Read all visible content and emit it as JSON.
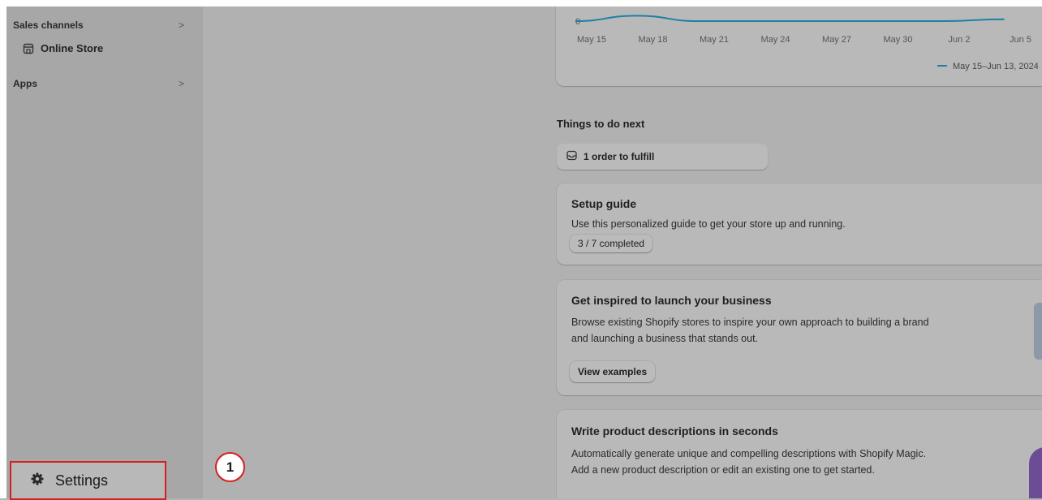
{
  "sidebar": {
    "sales_channels": {
      "label": "Sales channels",
      "chevron": ">"
    },
    "online_store": {
      "label": "Online Store",
      "icon": "storefront-icon"
    },
    "apps": {
      "label": "Apps",
      "chevron": ">"
    },
    "settings": {
      "label": "Settings",
      "icon": "gear-icon"
    }
  },
  "annotation": {
    "step": "1",
    "color": "#d32020"
  },
  "chart_data": {
    "type": "line",
    "x": [
      "May 15",
      "May 18",
      "May 21",
      "May 24",
      "May 27",
      "May 30",
      "Jun 2",
      "Jun 5"
    ],
    "y_tick_labels": [
      "0"
    ],
    "series": [
      {
        "name": "May 15–Jun 13, 2024",
        "color": "#1f7fa3",
        "values": [
          0,
          0.3,
          0,
          0,
          0,
          0,
          0,
          0.1
        ]
      }
    ],
    "legend_position": "bottom-right"
  },
  "things_to_do": {
    "title": "Things to do next",
    "fulfill": {
      "label": "1 order to fulfill",
      "icon": "inbox-icon"
    }
  },
  "setup_guide": {
    "title": "Setup guide",
    "text": "Use this personalized guide to get your store up and running.",
    "progress_label": "3 / 7 completed",
    "completed": 3,
    "total": 7
  },
  "inspire": {
    "title": "Get inspired to launch your business",
    "line1": "Browse existing Shopify stores to inspire your own approach to building a brand",
    "line2": "and launching a business that stands out.",
    "button": "View examples"
  },
  "descriptions": {
    "title": "Write product descriptions in seconds",
    "line1": "Automatically generate unique and compelling descriptions with Shopify Magic.",
    "line2": "Add a new product description or edit an existing one to get started."
  }
}
